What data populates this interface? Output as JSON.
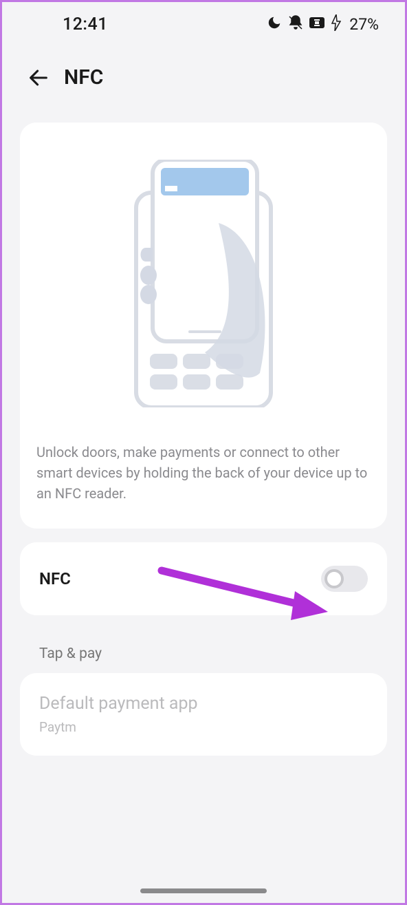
{
  "status": {
    "time": "12:41",
    "battery_pct": "27%"
  },
  "header": {
    "title": "NFC"
  },
  "main": {
    "description": "Unlock doors, make payments or connect to other smart devices by holding the back of your device up to an NFC reader.",
    "toggle": {
      "label": "NFC",
      "state": "off"
    }
  },
  "sections": {
    "tap_pay": {
      "header": "Tap & pay",
      "item": {
        "title": "Default payment app",
        "subtitle": "Paytm"
      }
    }
  },
  "colors": {
    "accent_arrow": "#b030d8"
  }
}
